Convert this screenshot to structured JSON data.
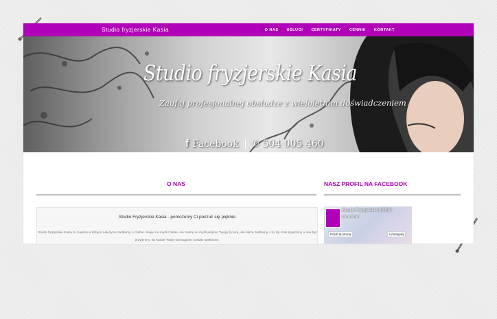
{
  "nav": {
    "brand": "Studio fryzjerskie Kasia",
    "items": [
      "O NAS",
      "USLUGI",
      "CERTYFIKATY",
      "CENNIK",
      "KONTAKT"
    ]
  },
  "hero": {
    "title": "Studio fryzjerskie Kasia",
    "subtitle": "Zaufaj profesjonalnej obsłudze z wieloletnim doświadczeniem",
    "facebook_label": "Facebook",
    "phone": "504 005 460"
  },
  "about": {
    "heading": "O NAS",
    "box_title": "Studio Fryzjerskie Kasia - pomożemy Ci poczuć się pięknie",
    "text": "Studio fryzjerskie Kasia to miejsce w którym należycie zadbamy o Ciebie. Mając na myśli Ciebie, nie mamy na myśli jedynie Twoją fryzurę, ale także zadbamy o to, by czas spędzony u nas był przyjemny. By każde Twoje wymaganie zostało spełnione."
  },
  "facebook": {
    "heading": "NASZ PROFIL NA FACEBOOK",
    "page_name": "Studio Fryzjerskie KASIA",
    "likes": "280 polubień",
    "like_button": "Polub tę stronę",
    "share_button": "Udostępnij"
  },
  "colors": {
    "accent": "#b000b8"
  }
}
